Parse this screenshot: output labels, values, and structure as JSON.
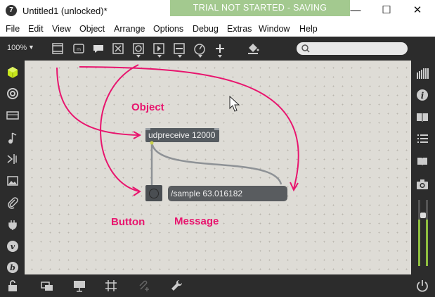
{
  "window": {
    "app_icon": "7",
    "title": "Untitled1 (unlocked)*",
    "trial_banner": "TRIAL NOT STARTED - SAVING DISABLED",
    "minimize_glyph": "—",
    "maximize_glyph": "☐",
    "close_glyph": "✕"
  },
  "menu": [
    "File",
    "Edit",
    "View",
    "Object",
    "Arrange",
    "Options",
    "Debug",
    "Extras",
    "Window",
    "Help"
  ],
  "toolbar": {
    "zoom": "100%",
    "icons": [
      "new-object-icon",
      "message-icon",
      "comment-icon",
      "toggle-icon",
      "button-icon",
      "play-icon",
      "slider-icon",
      "dial-icon",
      "add-icon",
      "paint-bucket-icon"
    ],
    "search_placeholder": ""
  },
  "left_sidebar": [
    "cube-icon",
    "circle-icon",
    "keyboard-icon",
    "music-note-icon",
    "split-icon",
    "image-icon",
    "paperclip-icon",
    "plug-icon",
    "vimeo-icon",
    "behance-icon"
  ],
  "right_sidebar": [
    "grid-icon",
    "info-icon",
    "book-icon",
    "list-icon",
    "reference-icon",
    "camera-icon",
    "level-meter-icon"
  ],
  "bottom_bar": [
    "lock-icon",
    "presentation-icon",
    "screen-icon",
    "grid-icon",
    "attach-icon",
    "wrench-icon",
    "power-icon"
  ],
  "patch": {
    "udpreceive": "udpreceive 12000",
    "message": "/sample 63.016182"
  },
  "annotations": {
    "object": "Object",
    "button": "Button",
    "message": "Message"
  },
  "colors": {
    "accent": "#e8156e",
    "banner": "#a3c98f",
    "chrome": "#2c2c2c",
    "canvas": "#dedcd6"
  }
}
